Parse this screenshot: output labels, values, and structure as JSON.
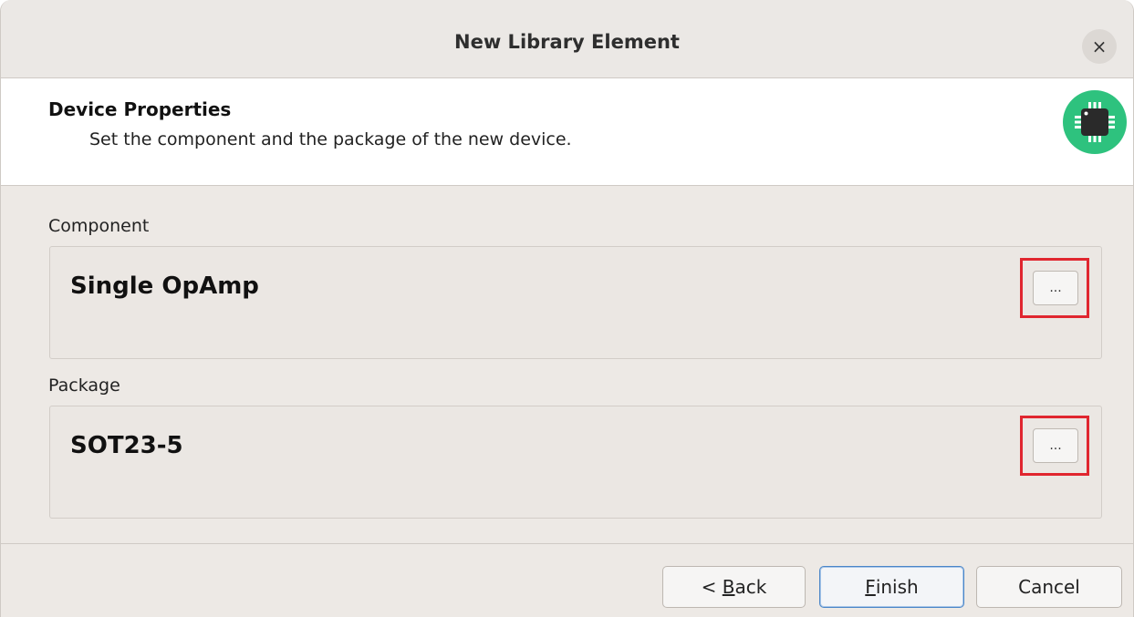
{
  "window": {
    "title": "New Library Element",
    "close_label": "×"
  },
  "header": {
    "title": "Device Properties",
    "subtitle": "Set the component and the package of the new device.",
    "icon": "chip-icon",
    "icon_color": "#2ec27e"
  },
  "component": {
    "label": "Component",
    "value": "Single OpAmp",
    "browse_label": "..."
  },
  "package": {
    "label": "Package",
    "value": "SOT23-5",
    "browse_label": "..."
  },
  "buttons": {
    "back_prefix": "< ",
    "back_mnemonic": "B",
    "back_rest": "ack",
    "finish_mnemonic": "F",
    "finish_rest": "inish",
    "cancel": "Cancel"
  },
  "colors": {
    "highlight": "#e0262f",
    "default_button_border": "#4a86c8"
  }
}
